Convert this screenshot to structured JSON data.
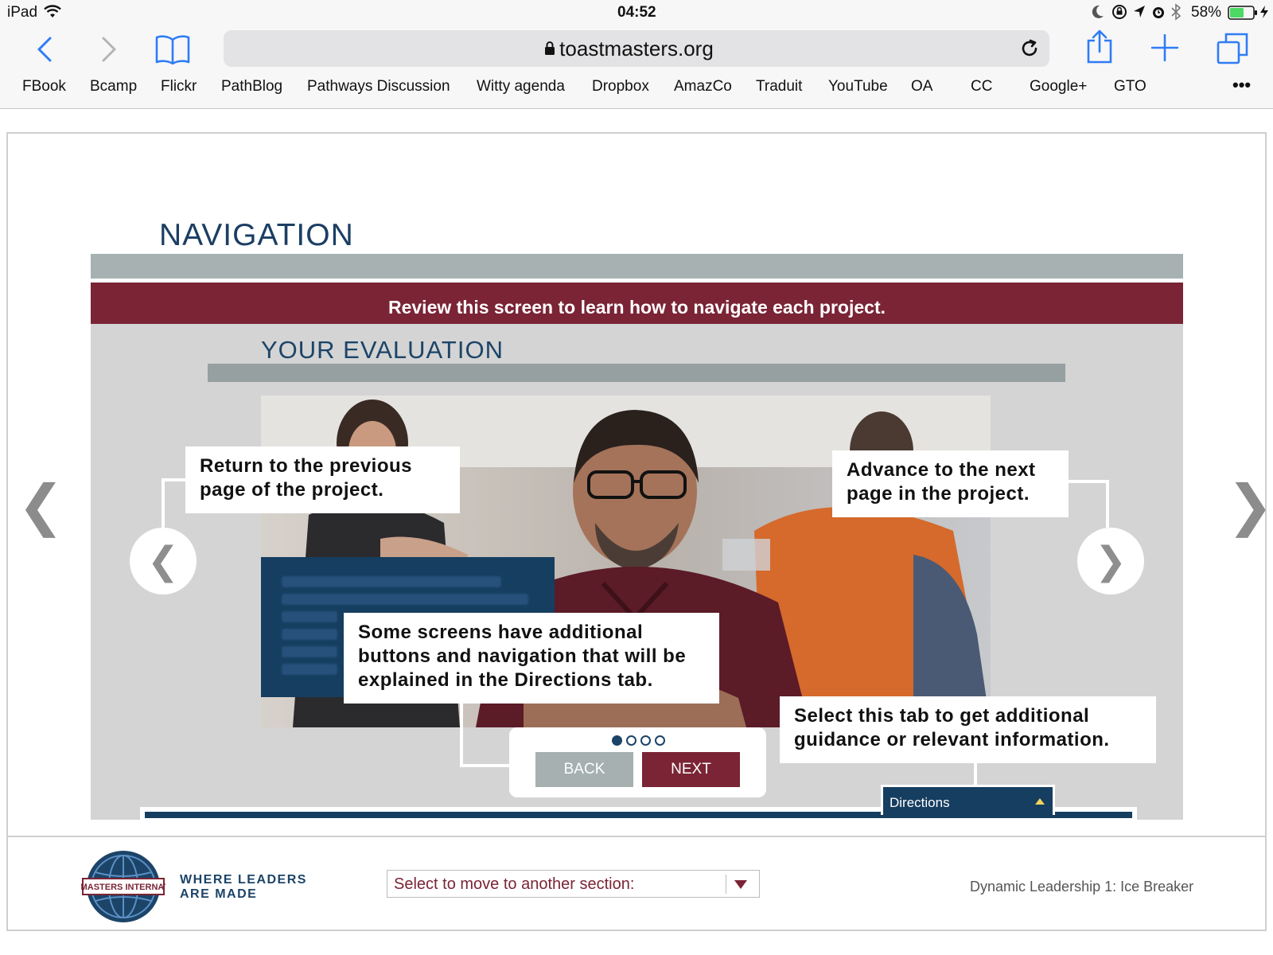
{
  "status_bar": {
    "device": "iPad",
    "time": "04:52",
    "battery": "58%",
    "icons": [
      "wifi-icon",
      "moon-icon",
      "rotation-lock-icon",
      "location-icon",
      "alarm-icon",
      "bluetooth-icon",
      "battery-icon",
      "charging-icon"
    ]
  },
  "toolbar": {
    "url": "toastmasters.org",
    "icons": [
      "back-icon",
      "forward-icon",
      "bookmarks-icon",
      "lock-icon",
      "reload-icon",
      "share-icon",
      "new-tab-icon",
      "tabs-icon"
    ]
  },
  "bookmarks": [
    "FBook",
    "Bcamp",
    "Flickr",
    "PathBlog",
    "Pathways Discussion",
    "Witty agenda",
    "Dropbox",
    "AmazCo",
    "Traduit",
    "YouTube",
    "OA",
    "CC",
    "Google+",
    "GTO"
  ],
  "bookmarks_more": "•••",
  "page": {
    "title": "NAVIGATION",
    "banner": "Review this screen to learn how to navigate each project.",
    "section_title": "YOUR EVALUATION",
    "callouts": {
      "back": "Return to the previous page of the project.",
      "next": "Advance to the next page in the project.",
      "additional": "Some screens have additional buttons and navigation that will be explained in the Directions tab.",
      "tab": "Select this tab to get additional guidance or relevant information."
    },
    "back_button": "BACK",
    "next_button": "NEXT",
    "directions_tab": "Directions",
    "prev_arrow": "❮",
    "next_arrow": "❯",
    "pager": {
      "total": 4,
      "current": 1
    }
  },
  "footer": {
    "logo_text": "TOASTMASTERS INTERNATIONAL",
    "tagline_line1": "WHERE LEADERS",
    "tagline_line2": "ARE MADE",
    "select_label": "Select to move to another section:",
    "course": "Dynamic Leadership 1: Ice Breaker"
  },
  "colors": {
    "maroon": "#7a2435",
    "navy": "#1c4468",
    "gray_rule": "#a7b1b1",
    "ios_blue": "#2f7cf6"
  }
}
